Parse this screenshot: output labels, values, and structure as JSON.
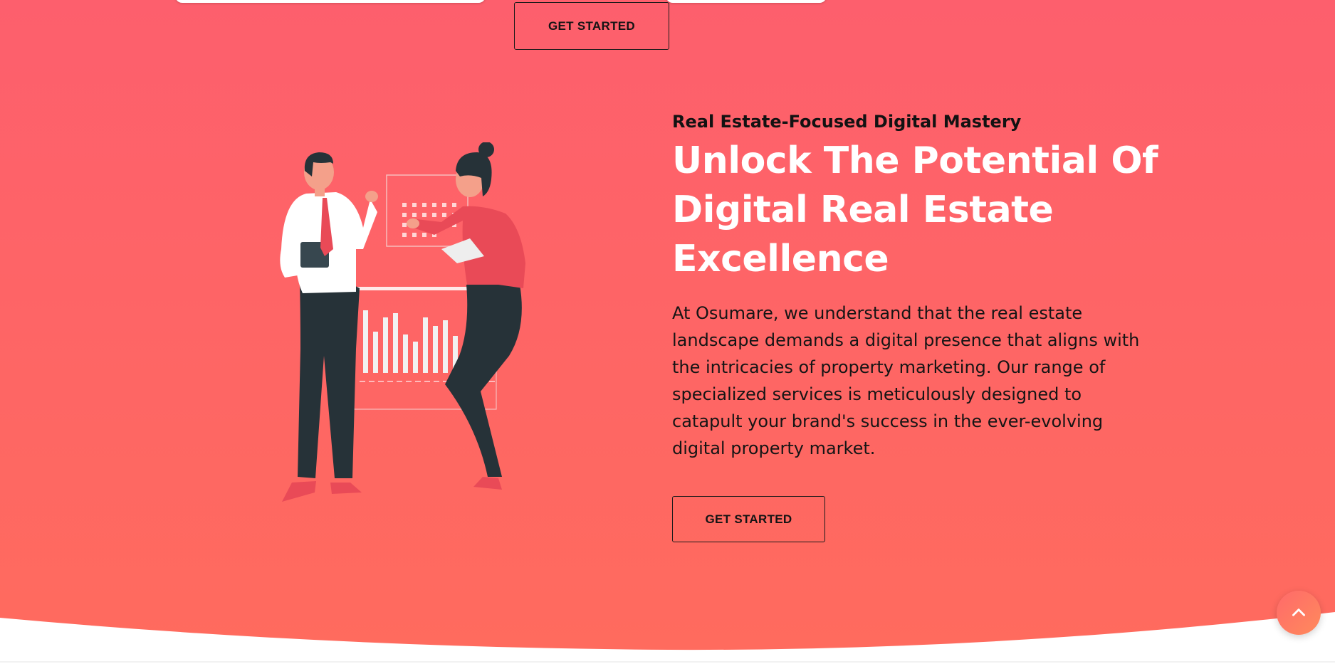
{
  "hero": {
    "eyebrow": "Real Estate-Focused Digital Mastery",
    "headline_lines": [
      "Unlock The Potential Of",
      "Digital Real Estate",
      "Excellence"
    ],
    "paragraph_lines": [
      "At Osumare, we understand that the real estate",
      "landscape demands a digital presence that aligns with",
      "the intricacies of property marketing. Our range of",
      "specialized services is meticulously designed to",
      "catapult your brand's success in the ever-evolving",
      "digital property market."
    ],
    "cta_label": "GET STARTED"
  },
  "top_cta": {
    "label": "GET STARTED"
  },
  "colors": {
    "gradient_top": "#fd5f6d",
    "gradient_bottom": "#ff6b5e",
    "text_dark": "#141414",
    "headline": "#ffffff"
  },
  "icons": {
    "scroll_top": "chevron-up-icon"
  }
}
